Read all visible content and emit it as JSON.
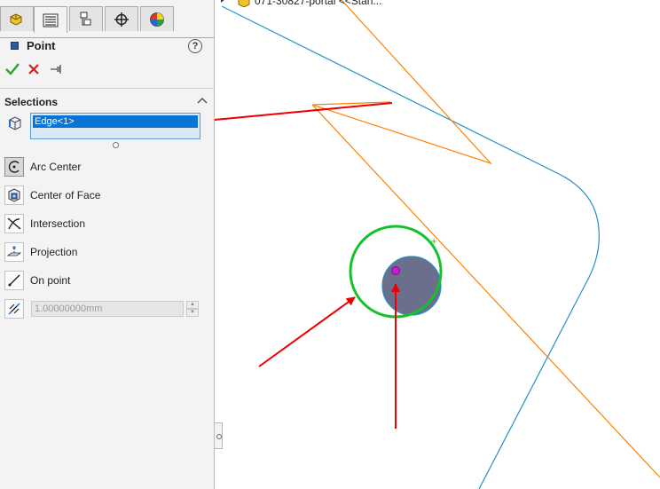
{
  "property_manager": {
    "title": "Point",
    "tabs": [
      {
        "name": "featuremanager-tab",
        "icon": "feature-manager-icon"
      },
      {
        "name": "propertymanager-tab",
        "icon": "property-manager-icon",
        "active": true
      },
      {
        "name": "configurationmanager-tab",
        "icon": "configuration-manager-icon"
      },
      {
        "name": "dimxpert-tab",
        "icon": "dimxpert-icon"
      },
      {
        "name": "display-manager-tab",
        "icon": "display-manager-icon"
      }
    ],
    "actions": {
      "ok_icon": "checkmark-icon",
      "cancel_icon": "x-icon",
      "pin_icon": "pushpin-icon"
    },
    "selections": {
      "header": "Selections",
      "items": [
        "Edge<1>"
      ]
    },
    "options": [
      {
        "label": "Arc Center",
        "icon": "arc-center-icon",
        "selected": true
      },
      {
        "label": "Center of Face",
        "icon": "center-of-face-icon"
      },
      {
        "label": "Intersection",
        "icon": "intersection-icon"
      },
      {
        "label": "Projection",
        "icon": "projection-icon"
      },
      {
        "label": "On point",
        "icon": "on-point-icon"
      }
    ],
    "distance": {
      "value": "1.00000000mm",
      "icon": "along-curve-distance-icon"
    }
  },
  "feature_tree": {
    "item_text": "071-30827-portal <<Stan..."
  },
  "colors": {
    "accent_selection": "#0a74d6",
    "orange_edge": "#ff8000",
    "blue_edge": "#2291c8",
    "green_circle": "#18c02c",
    "red_arrow": "#ee0000",
    "face_fill": "#6b6f8c",
    "point_marker": "#c21ed4"
  }
}
